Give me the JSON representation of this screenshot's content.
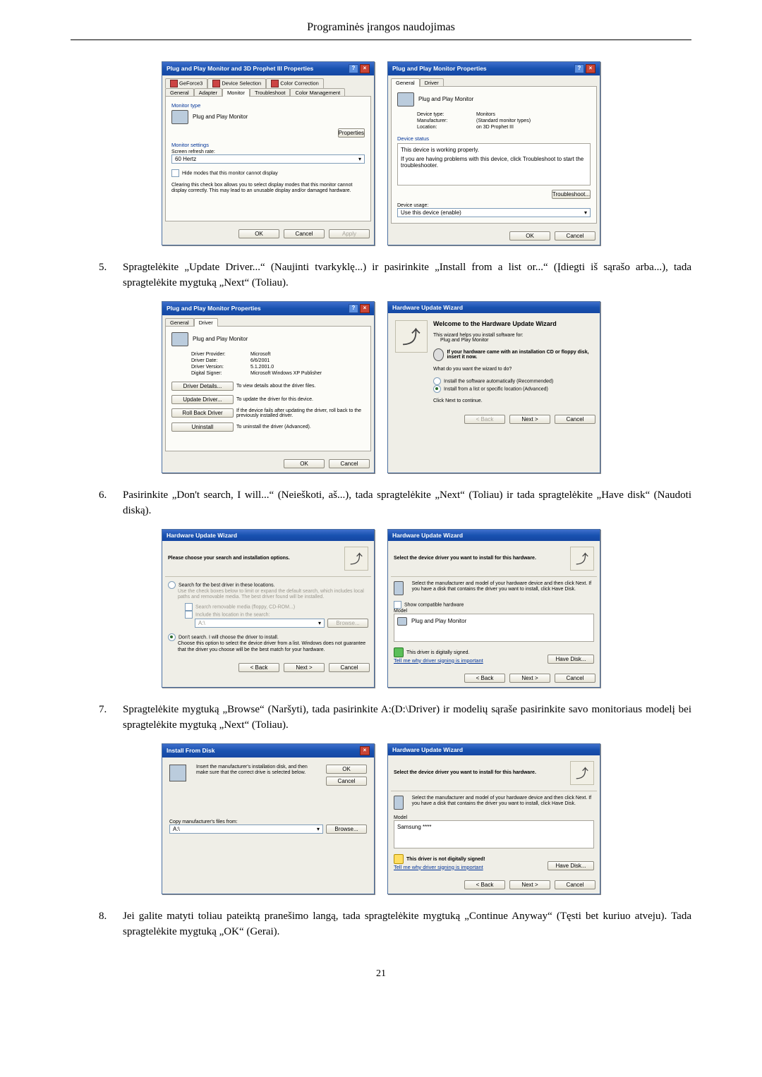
{
  "page": {
    "title": "Programinės įrangos naudojimas",
    "number": "21"
  },
  "steps": {
    "s5": {
      "num": "5.",
      "text": "Spragtelėkite „Update Driver...“ (Naujinti tvarkyklę...) ir pasirinkite „Install from a list or...“ (Įdiegti iš sąrašo arba...), tada spragtelėkite mygtuką „Next“ (Toliau)."
    },
    "s6": {
      "num": "6.",
      "text": "Pasirinkite „Don't search, I will...“ (Neieškoti, aš...), tada spragtelėkite „Next“ (Toliau) ir tada spragtelėkite „Have disk“ (Naudoti diską)."
    },
    "s7": {
      "num": "7.",
      "text": "Spragtelėkite mygtuką „Browse“ (Naršyti), tada pasirinkite A:(D:\\Driver) ir modelių sąraše pasirinkite savo monitoriaus modelį bei spragtelėkite mygtuką „Next“ (Toliau)."
    },
    "s8": {
      "num": "8.",
      "text": "Jei galite matyti toliau pateiktą pranešimo langą, tada spragtelėkite mygtuką „Continue Anyway“ (Tęsti bet kuriuo atveju). Tada spragtelėkite mygtuką „OK“ (Gerai)."
    }
  },
  "common": {
    "ok": "OK",
    "cancel": "Cancel",
    "apply": "Apply",
    "back": "< Back",
    "next": "Next >",
    "browse": "Browse...",
    "troubleshoot": "Troubleshoot...",
    "properties": "Properties",
    "haveDisk": "Have Disk...",
    "pnp": "Plug and Play Monitor"
  },
  "d1": {
    "title": "Plug and Play Monitor and 3D Prophet III Properties",
    "tabs": {
      "geforce": "GeForce3",
      "devsel": "Device Selection",
      "colorc": "Color Correction",
      "general": "General",
      "adapter": "Adapter",
      "monitor": "Monitor",
      "trouble": "Troubleshoot",
      "colman": "Color Management"
    },
    "grp_type": "Monitor type",
    "grp_settings": "Monitor settings",
    "refresh_lbl": "Screen refresh rate:",
    "refresh_val": "60 Hertz",
    "hide_chk": "Hide modes that this monitor cannot display",
    "hide_txt": "Clearing this check box allows you to select display modes that this monitor cannot display correctly. This may lead to an unusable display and/or damaged hardware."
  },
  "d2": {
    "title": "Plug and Play Monitor Properties",
    "tabs": {
      "general": "General",
      "driver": "Driver"
    },
    "type_lbl": "Device type:",
    "type_val": "Monitors",
    "man_lbl": "Manufacturer:",
    "man_val": "(Standard monitor types)",
    "loc_lbl": "Location:",
    "loc_val": "on 3D Prophet III",
    "grp_status": "Device status",
    "status1": "This device is working properly.",
    "status2": "If you are having problems with this device, click Troubleshoot to start the troubleshooter.",
    "usage_lbl": "Device usage:",
    "usage_val": "Use this device (enable)"
  },
  "d3": {
    "title": "Plug and Play Monitor Properties",
    "tabs": {
      "general": "General",
      "driver": "Driver"
    },
    "prov_lbl": "Driver Provider:",
    "prov_val": "Microsoft",
    "date_lbl": "Driver Date:",
    "date_val": "6/6/2001",
    "ver_lbl": "Driver Version:",
    "ver_val": "5.1.2001.0",
    "sig_lbl": "Digital Signer:",
    "sig_val": "Microsoft Windows XP Publisher",
    "b1": "Driver Details...",
    "b1t": "To view details about the driver files.",
    "b2": "Update Driver...",
    "b2t": "To update the driver for this device.",
    "b3": "Roll Back Driver",
    "b3t": "If the device fails after updating the driver, roll back to the previously installed driver.",
    "b4": "Uninstall",
    "b4t": "To uninstall the driver (Advanced)."
  },
  "d4": {
    "title": "Hardware Update Wizard",
    "h": "Welcome to the Hardware Update Wizard",
    "t1": "This wizard helps you install software for:",
    "cd": "If your hardware came with an installation CD or floppy disk, insert it now.",
    "q": "What do you want the wizard to do?",
    "r1": "Install the software automatically (Recommended)",
    "r2": "Install from a list or specific location (Advanced)",
    "click": "Click Next to continue."
  },
  "d5": {
    "title": "Hardware Update Wizard",
    "h": "Please choose your search and installation options.",
    "r1": "Search for the best driver in these locations.",
    "r1t": "Use the check boxes below to limit or expand the default search, which includes local paths and removable media. The best driver found will be installed.",
    "c1": "Search removable media (floppy, CD-ROM...)",
    "c2": "Include this location in the search:",
    "loc": "A:\\",
    "r2": "Don't search. I will choose the driver to install.",
    "r2t": "Choose this option to select the device driver from a list. Windows does not guarantee that the driver you choose will be the best match for your hardware."
  },
  "d6": {
    "title": "Hardware Update Wizard",
    "h": "Select the device driver you want to install for this hardware.",
    "t": "Select the manufacturer and model of your hardware device and then click Next. If you have a disk that contains the driver you want to install, click Have Disk.",
    "chk": "Show compatible hardware",
    "mlbl": "Model",
    "signed": "This driver is digitally signed.",
    "link": "Tell me why driver signing is important"
  },
  "d7": {
    "title": "Install From Disk",
    "t": "Insert the manufacturer's installation disk, and then make sure that the correct drive is selected below.",
    "copy": "Copy manufacturer's files from:",
    "path": "A:\\"
  },
  "d8": {
    "title": "Hardware Update Wizard",
    "h": "Select the device driver you want to install for this hardware.",
    "t": "Select the manufacturer and model of your hardware device and then click Next. If you have a disk that contains the driver you want to install, click Have Disk.",
    "mlbl": "Model",
    "mval": "Samsung ****",
    "warn": "This driver is not digitally signed!",
    "link": "Tell me why driver signing is important"
  }
}
